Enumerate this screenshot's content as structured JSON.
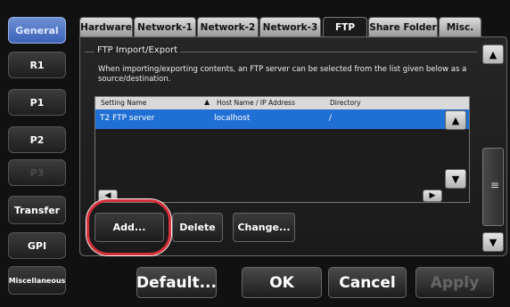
{
  "nav": {
    "items": [
      {
        "label": "General"
      },
      {
        "label": "R1"
      },
      {
        "label": "P1"
      },
      {
        "label": "P2"
      },
      {
        "label": "P3"
      },
      {
        "label": "Transfer"
      },
      {
        "label": "GPI"
      },
      {
        "label": "Miscellaneous"
      }
    ]
  },
  "tabs": [
    {
      "label": "Hardware"
    },
    {
      "label": "Network-1"
    },
    {
      "label": "Network-2"
    },
    {
      "label": "Network-3"
    },
    {
      "label": "FTP"
    },
    {
      "label": "Share Folder"
    },
    {
      "label": "Misc."
    }
  ],
  "ftp": {
    "section_title": "FTP Import/Export",
    "description": "When importing/exporting contents, an FTP server can be selected from the list given below as a source/destination.",
    "columns": {
      "setting_name": "Setting Name",
      "host": "Host Name / IP Address",
      "directory": "Directory"
    },
    "rows": [
      {
        "setting_name": "T2 FTP server",
        "host": "localhost",
        "directory": "/"
      }
    ],
    "add_label": "Add...",
    "delete_label": "Delete",
    "change_label": "Change..."
  },
  "footer": {
    "default_label": "Default...",
    "ok_label": "OK",
    "cancel_label": "Cancel",
    "apply_label": "Apply"
  },
  "colors": {
    "highlight": "#1f6fd4",
    "callout": "#d8303a",
    "active_nav": "#4f73c6"
  }
}
